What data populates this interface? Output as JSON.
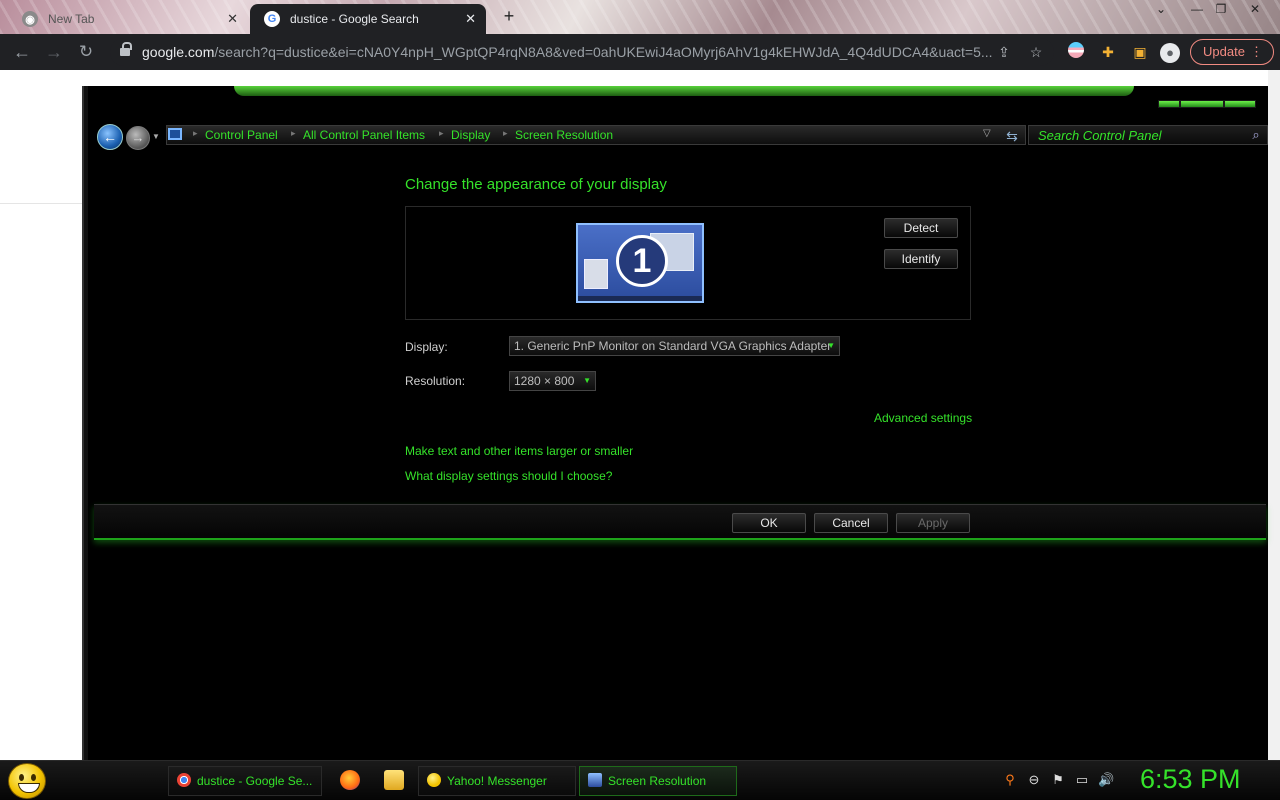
{
  "browser": {
    "tabs": [
      {
        "title": "New Tab",
        "close": "✕"
      },
      {
        "title": "dustice - Google Search",
        "close": "✕"
      }
    ],
    "new_tab": "+",
    "window_controls": [
      "⌄",
      "—",
      "❐",
      "✕"
    ],
    "url_host": "google.com",
    "url_rest": "/search?q=dustice&ei=cNA0Y4npH_WGptQP4rqN8A8&ved=0ahUKEwiJ4aOMyrj6AhV1g4kEHWJdA_4Q4dUDCA4&uact=5...",
    "update_label": "Update",
    "icons": {
      "back": "back-arrow-icon",
      "forward": "forward-arrow-icon",
      "reload": "reload-icon",
      "share": "share-icon",
      "bookmark": "star-icon",
      "extensions": "puzzle-icon",
      "sidepanel": "side-panel-icon",
      "profile": "profile-icon",
      "menu": "kebab-menu-icon"
    }
  },
  "control_panel": {
    "breadcrumbs": [
      "Control Panel",
      "All Control Panel Items",
      "Display",
      "Screen Resolution"
    ],
    "search_placeholder": "Search Control Panel",
    "heading": "Change the appearance of your display",
    "monitor_number": "1",
    "detect_label": "Detect",
    "identify_label": "Identify",
    "display_label": "Display:",
    "display_value": "1. Generic PnP Monitor on Standard VGA Graphics Adapter",
    "resolution_label": "Resolution:",
    "resolution_value": "1280 × 800",
    "advanced_link": "Advanced settings",
    "link_text_size": "Make text and other items larger or smaller",
    "link_help": "What display settings should I choose?",
    "ok_label": "OK",
    "cancel_label": "Cancel",
    "apply_label": "Apply",
    "accent_color": "#35e22a"
  },
  "taskbar": {
    "tasks": [
      {
        "label": "dustice - Google Se...",
        "icon": "chrome-icon"
      },
      {
        "label": "Yahoo! Messenger",
        "icon": "yahoo-messenger-icon"
      },
      {
        "label": "Screen Resolution",
        "icon": "screen-resolution-icon"
      }
    ],
    "clock": "6:53 PM"
  }
}
